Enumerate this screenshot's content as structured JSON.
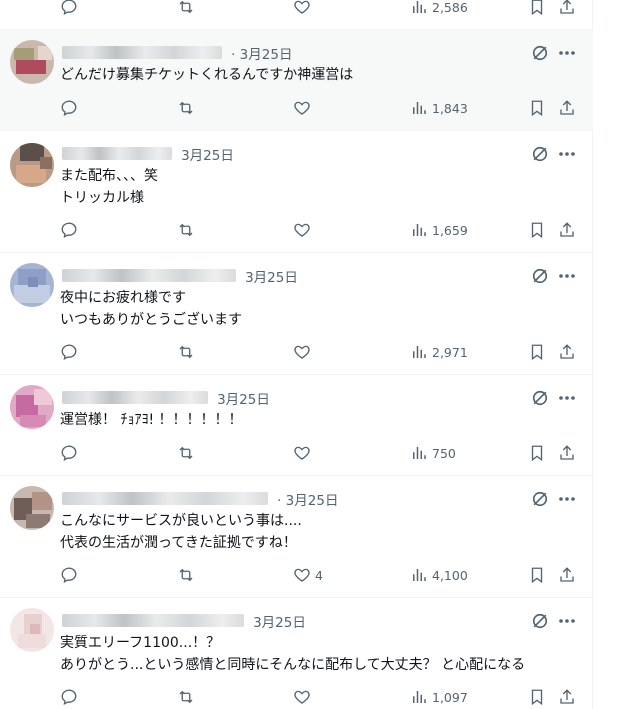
{
  "top_row": {
    "views": "2,586"
  },
  "tweets": [
    {
      "username": "",
      "date": "· 3月25日",
      "lines": [
        "どんだけ募集チケットくれるんですか神運営は"
      ],
      "likes": "",
      "views": "1,843"
    },
    {
      "username": "",
      "date": "3月25日",
      "lines": [
        "また配布、、、笑",
        "トリッカル様"
      ],
      "likes": "",
      "views": "1,659"
    },
    {
      "username": "",
      "date": "3月25日",
      "lines": [
        "夜中にお疲れ様です",
        "いつもありがとうございます"
      ],
      "likes": "",
      "views": "2,971"
    },
    {
      "username": "",
      "date": "3月25日",
      "lines": [
        "運営様！ ﾁｮｱﾖ! ！！！！！！"
      ],
      "likes": "",
      "views": "750"
    },
    {
      "username": "",
      "date": "· 3月25日",
      "lines": [
        "こんなにサービスが良いという事は....",
        "代表の生活が潤ってきた証拠ですね！"
      ],
      "likes": "4",
      "views": "4,100"
    },
    {
      "username": "",
      "date": "3月25日",
      "lines": [
        "実質エリーフ1100...！？",
        "ありがとう...という感情と同時にそんなに配布して大丈夫？ と心配になる"
      ],
      "likes": "",
      "views": "1,097"
    }
  ],
  "icons": [
    "reply-icon",
    "retweet-icon",
    "like-icon",
    "views-icon",
    "bookmark-icon",
    "share-icon",
    "grok-icon",
    "more-icon"
  ]
}
